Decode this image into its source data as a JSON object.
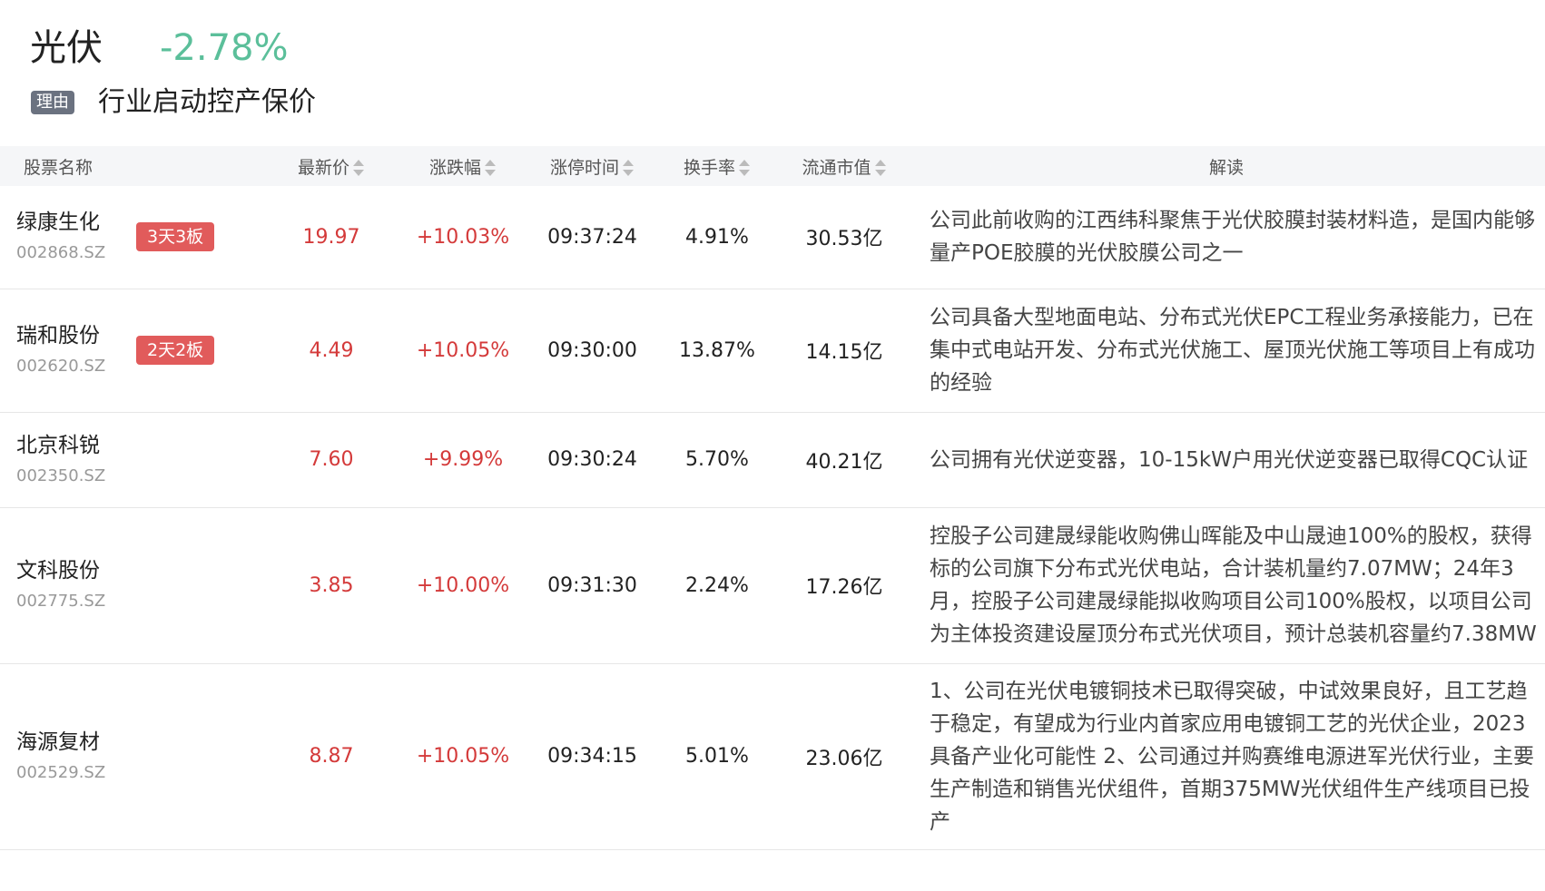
{
  "header": {
    "sector_name": "光伏",
    "sector_change": "-2.78%",
    "reason_tag": "理由",
    "reason_text": "行业启动控产保价"
  },
  "table": {
    "columns": [
      "股票名称",
      "最新价",
      "涨跌幅",
      "涨停时间",
      "换手率",
      "流通市值",
      "解读"
    ],
    "rows": [
      {
        "name": "绿康生化",
        "code": "002868.SZ",
        "tag": "3天3板",
        "price": "19.97",
        "change": "+10.03%",
        "time": "09:37:24",
        "turnover": "4.91%",
        "cap": "30.53亿",
        "desc": "公司此前收购的江西纬科聚焦于光伏胶膜封装材料造，是国内能够量产POE胶膜的光伏胶膜公司之一"
      },
      {
        "name": "瑞和股份",
        "code": "002620.SZ",
        "tag": "2天2板",
        "price": "4.49",
        "change": "+10.05%",
        "time": "09:30:00",
        "turnover": "13.87%",
        "cap": "14.15亿",
        "desc": "公司具备大型地面电站、分布式光伏EPC工程业务承接能力，已在集中式电站开发、分布式光伏施工、屋顶光伏施工等项目上有成功的经验"
      },
      {
        "name": "北京科锐",
        "code": "002350.SZ",
        "tag": "",
        "price": "7.60",
        "change": "+9.99%",
        "time": "09:30:24",
        "turnover": "5.70%",
        "cap": "40.21亿",
        "desc": "公司拥有光伏逆变器，10-15kW户用光伏逆变器已取得CQC认证"
      },
      {
        "name": "文科股份",
        "code": "002775.SZ",
        "tag": "",
        "price": "3.85",
        "change": "+10.00%",
        "time": "09:31:30",
        "turnover": "2.24%",
        "cap": "17.26亿",
        "desc": "控股子公司建晟绿能收购佛山晖能及中山晟迪100%的股权，获得标的公司旗下分布式光伏电站，合计装机量约7.07MW；24年3月，控股子公司建晟绿能拟收购项目公司100%股权，以项目公司为主体投资建设屋顶分布式光伏项目，预计总装机容量约7.38MW"
      },
      {
        "name": "海源复材",
        "code": "002529.SZ",
        "tag": "",
        "price": "8.87",
        "change": "+10.05%",
        "time": "09:34:15",
        "turnover": "5.01%",
        "cap": "23.06亿",
        "desc": "1、公司在光伏电镀铜技术已取得突破，中试效果良好，且工艺趋于稳定，有望成为行业内首家应用电镀铜工艺的光伏企业，2023具备产业化可能性 2、公司通过并购赛维电源进军光伏行业，主要生产制造和销售光伏组件，首期375MW光伏组件生产线项目已投产"
      }
    ]
  },
  "icons": {
    "sort": "sort-icon"
  },
  "colors": {
    "up": "#d43a3a",
    "down": "#5bbf9a",
    "tag": "#e15b5b",
    "reason_tag": "#6b7280"
  }
}
